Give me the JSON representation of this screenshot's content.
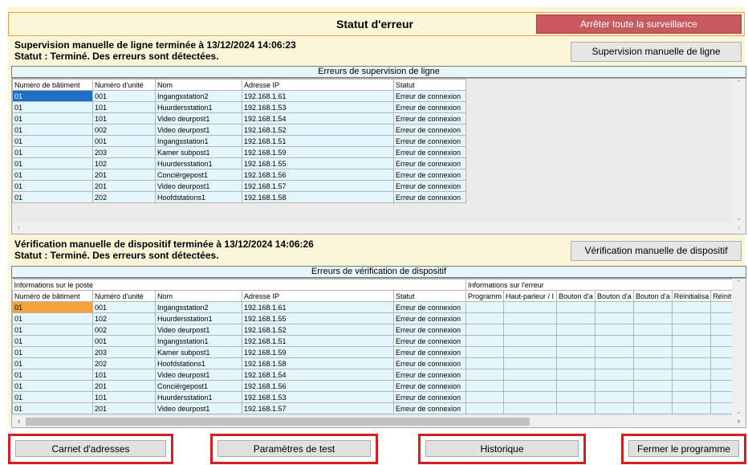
{
  "header": {
    "title": "Statut d'erreur",
    "stop_button": "Arrêter toute la surveillance"
  },
  "line_supervision": {
    "status_line1": "Supervision manuelle de ligne terminée à 13/12/2024 14:06:23",
    "status_line2": "Statut : Terminé. Des erreurs sont détectées.",
    "button": "Supervision manuelle de ligne",
    "section_title": "Erreurs de supervision de ligne",
    "columns": [
      "Numéro de bâtiment",
      "Numéro d'unité",
      "Nom",
      "Adresse IP",
      "Statut"
    ],
    "rows": [
      [
        "01",
        "001",
        "Ingangsstation2",
        "192.168.1.61",
        "Erreur de connexion"
      ],
      [
        "01",
        "101",
        "Huurdersstation1",
        "192.168.1.53",
        "Erreur de connexion"
      ],
      [
        "01",
        "101",
        "Video deurpost1",
        "192.168.1.54",
        "Erreur de connexion"
      ],
      [
        "01",
        "002",
        "Video deurpost1",
        "192.168.1.52",
        "Erreur de connexion"
      ],
      [
        "01",
        "001",
        "Ingangsstation1",
        "192.168.1.51",
        "Erreur de connexion"
      ],
      [
        "01",
        "203",
        "Kamer subpost1",
        "192.168.1.59",
        "Erreur de connexion"
      ],
      [
        "01",
        "102",
        "Huurdersstation1",
        "192.168.1.55",
        "Erreur de connexion"
      ],
      [
        "01",
        "201",
        "Conciërgepost1",
        "192.168.1.56",
        "Erreur de connexion"
      ],
      [
        "01",
        "201",
        "Video deurpost1",
        "192.168.1.57",
        "Erreur de connexion"
      ],
      [
        "01",
        "202",
        "Hoofdstations1",
        "192.168.1.58",
        "Erreur de connexion"
      ]
    ]
  },
  "device_check": {
    "status_line1": "Vérification manuelle de dispositif terminée à 13/12/2024 14:06:26",
    "status_line2": "Statut : Terminé. Des erreurs sont détectées.",
    "button": "Vérification manuelle de dispositif",
    "section_title": "Erreurs de vérification de dispositif",
    "group_station": "Informations sur le poste",
    "group_error": "Informations sur l'erreur",
    "columns": [
      "Numéro de bâtiment",
      "Numéro d'unité",
      "Nom",
      "Adresse IP",
      "Statut",
      "Programm",
      "Haut-parleur / I",
      "Bouton d'a",
      "Bouton d'a",
      "Bouton d'a",
      "Réinitialisa",
      "Réinitial"
    ],
    "rows": [
      [
        "01",
        "001",
        "Ingangsstation2",
        "192.168.1.61",
        "Erreur de connexion"
      ],
      [
        "01",
        "102",
        "Huurdersstation1",
        "192.168.1.55",
        "Erreur de connexion"
      ],
      [
        "01",
        "002",
        "Video deurpost1",
        "192.168.1.52",
        "Erreur de connexion"
      ],
      [
        "01",
        "001",
        "Ingangsstation1",
        "192.168.1.51",
        "Erreur de connexion"
      ],
      [
        "01",
        "203",
        "Kamer subpost1",
        "192.168.1.59",
        "Erreur de connexion"
      ],
      [
        "01",
        "202",
        "Hoofdstations1",
        "192.168.1.58",
        "Erreur de connexion"
      ],
      [
        "01",
        "101",
        "Video deurpost1",
        "192.168.1.54",
        "Erreur de connexion"
      ],
      [
        "01",
        "201",
        "Conciërgepost1",
        "192.168.1.56",
        "Erreur de connexion"
      ],
      [
        "01",
        "101",
        "Huurdersstation1",
        "192.168.1.53",
        "Erreur de connexion"
      ],
      [
        "01",
        "201",
        "Video deurpost1",
        "192.168.1.57",
        "Erreur de connexion"
      ]
    ]
  },
  "footer": {
    "address_book": "Carnet d'adresses",
    "test_settings": "Paramètres de test",
    "history": "Historique",
    "close_program": "Fermer le programme"
  },
  "colors": {
    "panel_bg": "#fbf6d8",
    "stop_button": "#c85a5e",
    "row_bg": "#e3f6fc",
    "highlight_border": "#d22020",
    "selected_blue": "#1e6fc8",
    "selected_orange": "#f4a23a"
  }
}
